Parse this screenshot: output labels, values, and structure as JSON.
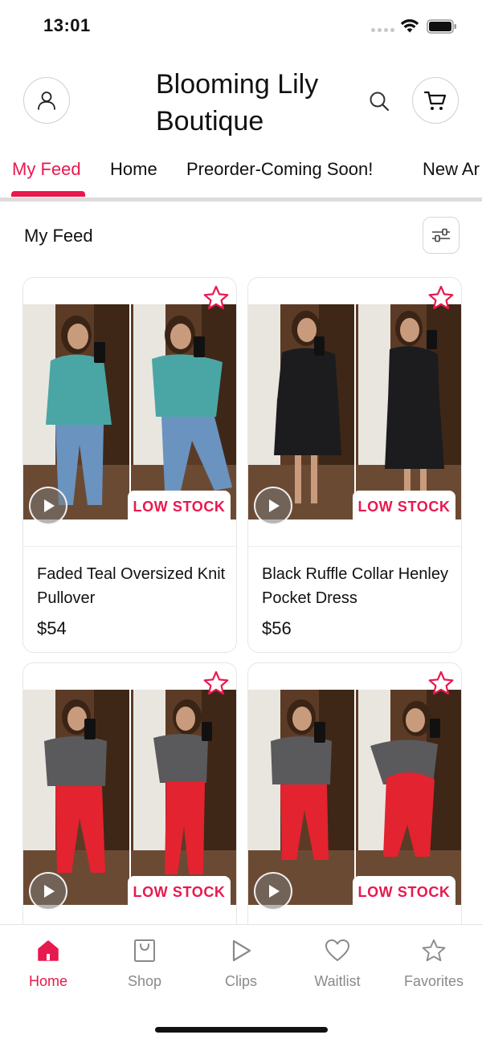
{
  "status_bar": {
    "time": "13:01"
  },
  "header": {
    "store_name": "Blooming Lily Boutique",
    "icons": {
      "profile": "user-icon",
      "search": "search-icon",
      "cart": "cart-icon"
    }
  },
  "tabs": [
    {
      "label": "My Feed",
      "active": true
    },
    {
      "label": "Home",
      "active": false
    },
    {
      "label": "Preorder-Coming Soon!",
      "active": false
    },
    {
      "label": "New Ar",
      "active": false
    }
  ],
  "feed": {
    "title": "My Feed",
    "filter_icon": "sliders-icon",
    "products": [
      {
        "name": "Faded Teal Oversized Knit Pullover",
        "price": "$54",
        "badge": "LOW STOCK",
        "top_color": "#4aa6a4",
        "bottom_color": "#6a93bf"
      },
      {
        "name": "Black Ruffle Collar Henley Pocket Dress",
        "price": "$56",
        "badge": "LOW STOCK",
        "top_color": "#1c1c1e",
        "bottom_color": "#1c1c1e"
      },
      {
        "name": "",
        "price": "",
        "badge": "LOW STOCK",
        "top_color": "#5a5a5c",
        "bottom_color": "#e3232f"
      },
      {
        "name": "",
        "price": "",
        "badge": "LOW STOCK",
        "top_color": "#5a5a5c",
        "bottom_color": "#e3232f"
      }
    ]
  },
  "bottom_nav": [
    {
      "label": "Home",
      "icon": "home-icon",
      "active": true
    },
    {
      "label": "Shop",
      "icon": "shopping-bag-icon",
      "active": false
    },
    {
      "label": "Clips",
      "icon": "play-icon",
      "active": false
    },
    {
      "label": "Waitlist",
      "icon": "heart-icon",
      "active": false
    },
    {
      "label": "Favorites",
      "icon": "star-icon",
      "active": false
    }
  ],
  "colors": {
    "accent": "#e8194e",
    "muted": "#8a8a8a",
    "divider": "#dcdcdc"
  }
}
